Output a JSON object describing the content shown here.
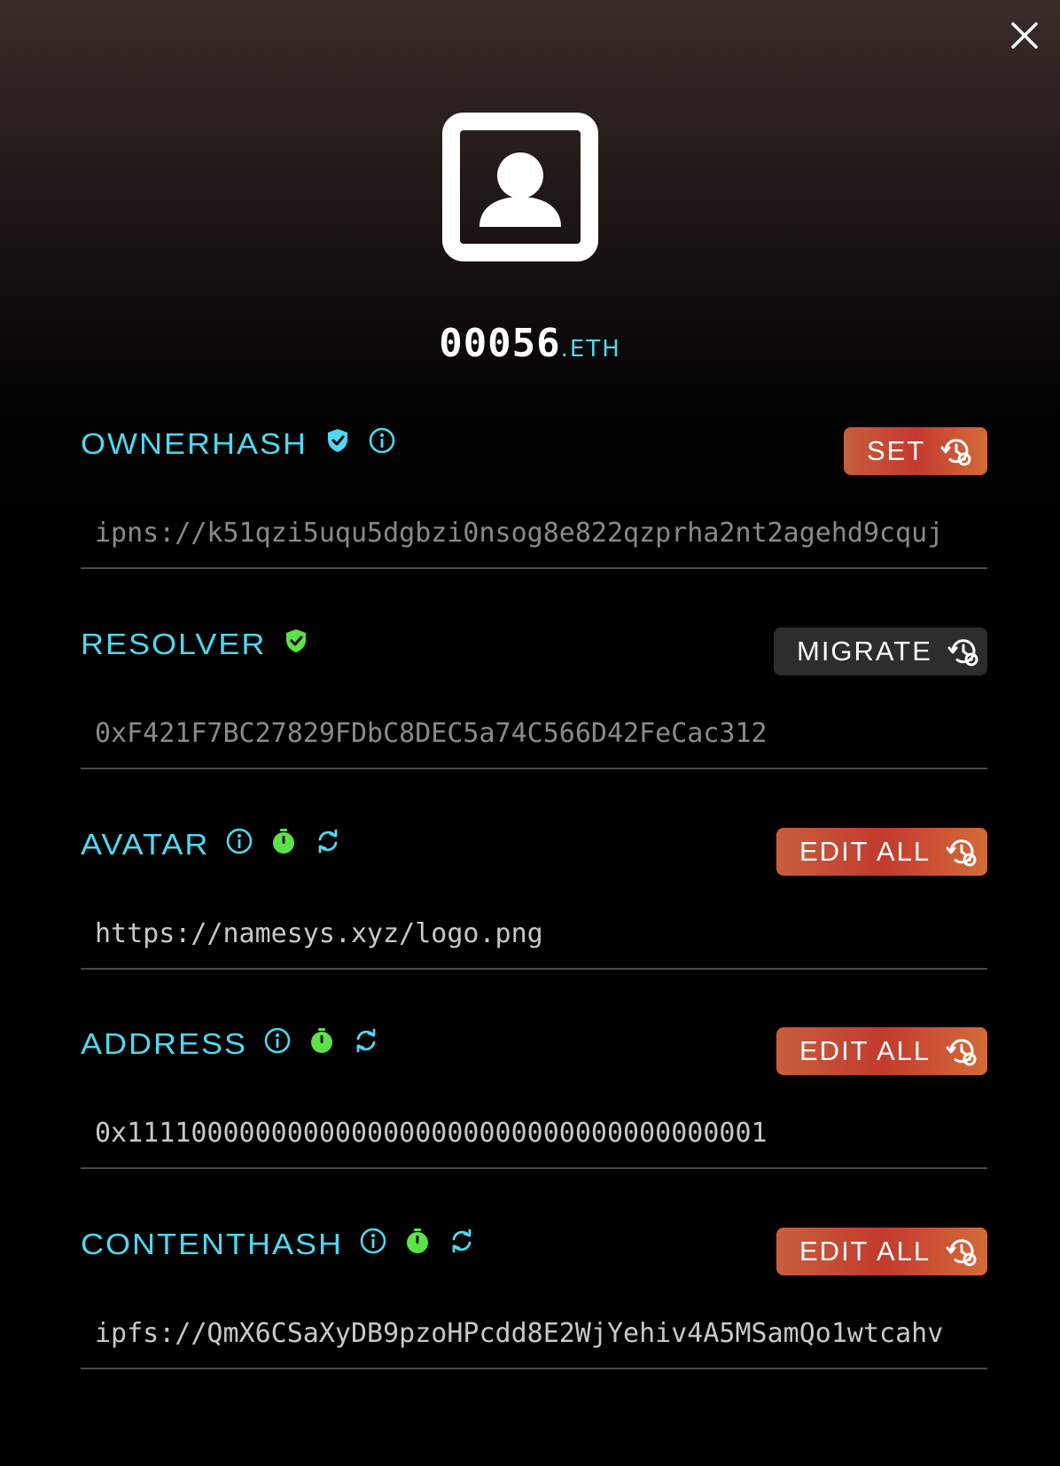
{
  "header": {
    "name": "00056",
    "tld": ".ETH"
  },
  "colors": {
    "accent_cyan": "#4fd8f0",
    "verified_green": "#5ee04a",
    "button_orange": "#c75f3c",
    "button_dark": "#2d2d2d"
  },
  "sections": {
    "ownerhash": {
      "label": "OWNERHASH",
      "button_label": "SET",
      "field_placeholder": "ipns://k51qzi5uqu5dgbzi0nsog8e822qzprha2nt2agehd9cquj",
      "icons": [
        "shield-check-icon",
        "info-icon"
      ]
    },
    "resolver": {
      "label": "RESOLVER",
      "button_label": "MIGRATE",
      "field_placeholder": "0xF421F7BC27829FDbC8DEC5a74C566D42FeCac312",
      "icons": [
        "shield-check-icon"
      ]
    },
    "avatar": {
      "label": "AVATAR",
      "button_label": "EDIT ALL",
      "field_value": "https://namesys.xyz/logo.png",
      "icons": [
        "info-icon",
        "stopwatch-icon",
        "refresh-icon"
      ]
    },
    "address": {
      "label": "ADDRESS",
      "button_label": "EDIT ALL",
      "field_value": "0x1111000000000000000000000000000000000001",
      "icons": [
        "info-icon",
        "stopwatch-icon",
        "refresh-icon"
      ]
    },
    "contenthash": {
      "label": "CONTENTHASH",
      "button_label": "EDIT ALL",
      "field_value": "ipfs://QmX6CSaXyDB9pzoHPcdd8E2WjYehiv4A5MSamQo1wtcahv",
      "icons": [
        "info-icon",
        "stopwatch-icon",
        "refresh-icon"
      ]
    }
  }
}
